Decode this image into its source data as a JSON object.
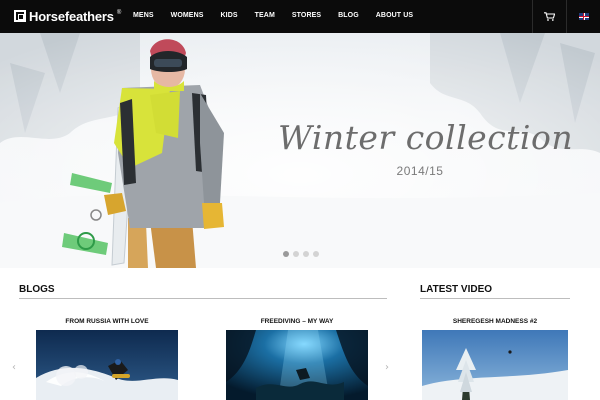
{
  "brand": {
    "name": "Horsefeathers",
    "reg": "®"
  },
  "nav": {
    "items": [
      {
        "label": "MENS"
      },
      {
        "label": "WOMENS"
      },
      {
        "label": "KIDS"
      },
      {
        "label": "TEAM"
      },
      {
        "label": "STORES"
      },
      {
        "label": "BLOG"
      },
      {
        "label": "ABOUT US"
      }
    ],
    "cart_icon": "cart-icon",
    "language_icon": "uk-flag-icon"
  },
  "hero": {
    "title": "Winter collection",
    "subtitle": "2014/15",
    "slides_total": 4,
    "active_slide": 1
  },
  "blogs": {
    "heading": "BLOGS",
    "posts": [
      {
        "title": "FROM RUSSIA WITH LOVE"
      },
      {
        "title": "FREEDIVING – MY WAY"
      }
    ],
    "prev_icon": "chevron-left-icon",
    "next_icon": "chevron-right-icon"
  },
  "latest_video": {
    "heading": "LATEST VIDEO",
    "title": "SHEREGESH MADNESS #2"
  },
  "colors": {
    "topbar": "#0b0b0b",
    "text": "#111111",
    "hero_text": "#6d6d6d",
    "rule": "#bdbdbd"
  }
}
